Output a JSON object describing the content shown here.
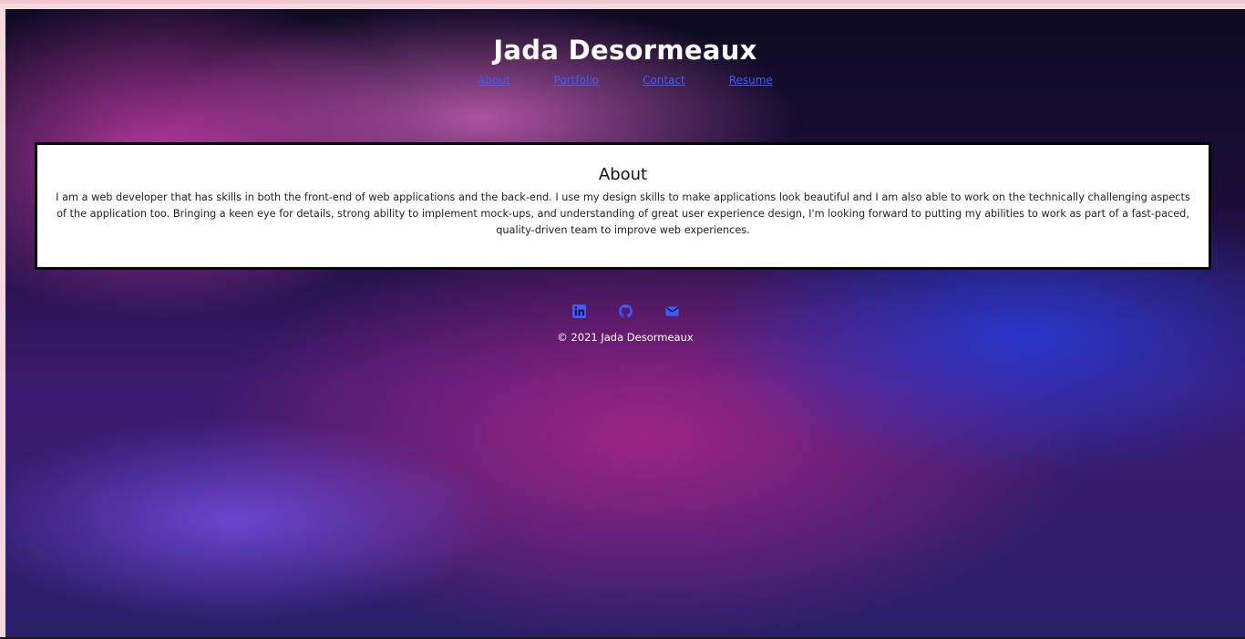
{
  "site": {
    "title": "Jada Desormeaux"
  },
  "nav": {
    "items": [
      {
        "label": "About"
      },
      {
        "label": "Portfolio"
      },
      {
        "label": "Contact"
      },
      {
        "label": "Resume"
      }
    ],
    "link_color": "#3b5cff"
  },
  "about": {
    "heading": "About",
    "body": "I am a web developer that has skills in both the front-end of web applications and the back-end. I use my design skills to make applications look beautiful and I am also able to work on the technically challenging aspects of the application too. Bringing a keen eye for details, strong ability to implement mock-ups, and understanding of great user experience design, I'm looking forward to putting my abilities to work as part of a fast-paced, quality-driven team to improve web experiences."
  },
  "footer": {
    "social": [
      {
        "icon": "linkedin-icon"
      },
      {
        "icon": "github-icon"
      },
      {
        "icon": "envelope-icon"
      }
    ],
    "copyright": "© 2021 Jada Desormeaux",
    "icon_color": "#3b5cff"
  }
}
